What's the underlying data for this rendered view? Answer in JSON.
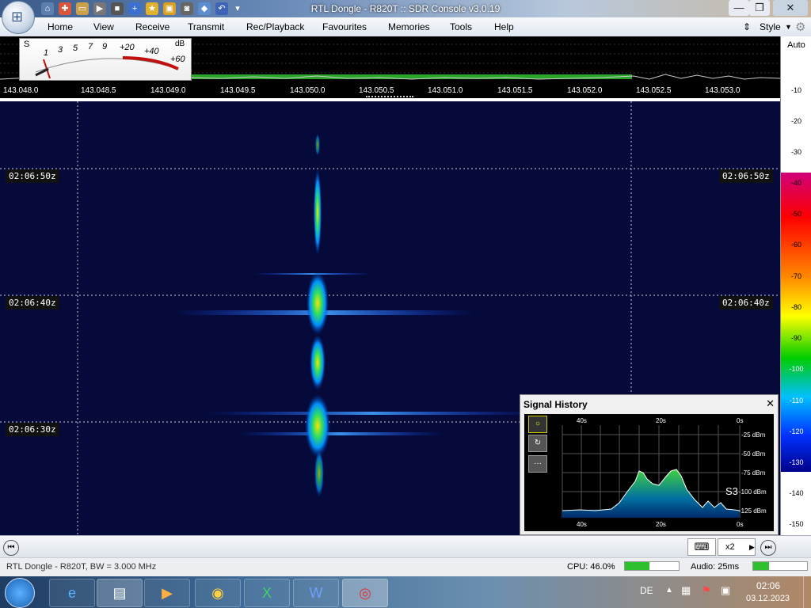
{
  "window": {
    "title": "RTL Dongle - R820T :: SDR Console v3.0.19",
    "minimize": "—",
    "maximize": "❐",
    "close": "✕"
  },
  "menu": {
    "items": [
      "Home",
      "View",
      "Receive",
      "Transmit",
      "Rec/Playback",
      "Favourites",
      "Memories",
      "Tools",
      "Help"
    ],
    "style_label": "Style"
  },
  "meter": {
    "s_label": "S",
    "db_label": "dB",
    "s_ticks": [
      "1",
      "3",
      "5",
      "7",
      "9"
    ],
    "db_ticks": [
      "+20",
      "+40",
      "+60"
    ]
  },
  "spectrum": {
    "frequencies": [
      "143.048.0",
      "143.048.5",
      "143.049.0",
      "143.049.5",
      "143.050.0",
      "143.050.5",
      "143.051.0",
      "143.051.5",
      "143.052.0",
      "143.052.5",
      "143.053.0"
    ]
  },
  "waterfall": {
    "time_labels": [
      "02:06:50z",
      "02:06:40z",
      "02:06:30z"
    ]
  },
  "right_scale": {
    "auto_label": "Auto",
    "levels": [
      "-10",
      "-20",
      "-30",
      "-40",
      "-50",
      "-60",
      "-70",
      "-80",
      "-90",
      "-100",
      "-110",
      "-120",
      "-130",
      "-140",
      "-150"
    ]
  },
  "signal_history": {
    "title": "Signal History",
    "close": "✕",
    "top_labels": [
      "40s",
      "20s",
      "0s"
    ],
    "bottom_labels": [
      "40s",
      "20s",
      "0s"
    ],
    "y_labels": [
      "-25 dBm",
      "-50 dBm",
      "-75 dBm",
      "-100 dBm",
      "-125 dBm"
    ],
    "s_reading": "S3",
    "buttons": [
      "○",
      "↻",
      "···"
    ]
  },
  "bottom_toolbar": {
    "keyboard_icon": "⌨",
    "zoom_label": "x2"
  },
  "status": {
    "device": "RTL Dongle - R820T, BW = 3.000 MHz",
    "cpu": "CPU: 46.0%",
    "audio": "Audio: 25ms",
    "cpu_level": 0.46,
    "audio_level": 0.3
  },
  "taskbar": {
    "lang": "DE",
    "time": "02:06",
    "date": "03.12.2023"
  },
  "colors": {
    "accent": "#2fc02f",
    "waterfall_bg": "#050a3a",
    "signal": "#ffd400"
  }
}
